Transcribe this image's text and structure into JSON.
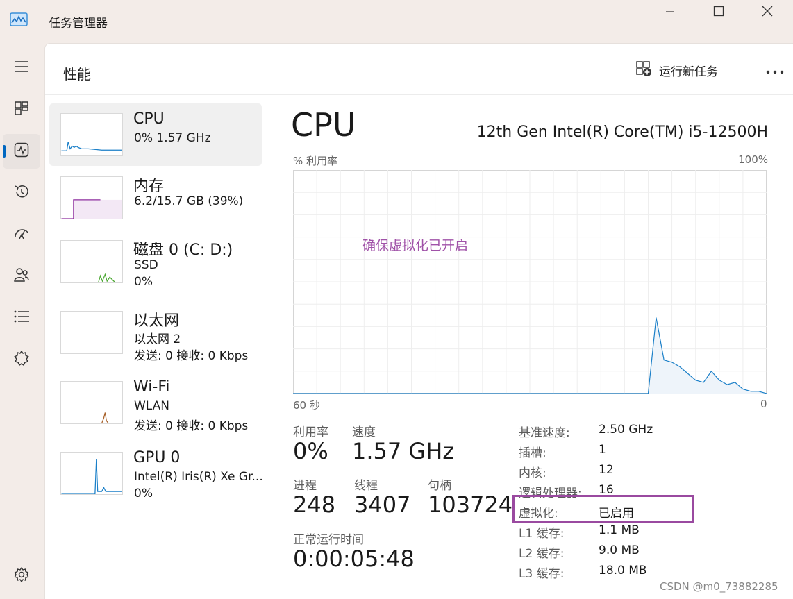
{
  "window": {
    "title": "任务管理器",
    "controls": {
      "minimize": "minimize-icon",
      "maximize": "maximize-icon",
      "close": "close-icon"
    }
  },
  "nav": {
    "items": [
      {
        "icon": "hamburger-icon"
      },
      {
        "icon": "processes-icon"
      },
      {
        "icon": "performance-icon"
      },
      {
        "icon": "app-history-icon"
      },
      {
        "icon": "startup-icon"
      },
      {
        "icon": "users-icon"
      },
      {
        "icon": "details-icon"
      },
      {
        "icon": "services-icon"
      }
    ],
    "settings_icon": "settings-icon"
  },
  "header": {
    "title": "性能",
    "run_task_label": "运行新任务",
    "more_icon": "more-icon"
  },
  "devices": [
    {
      "name": "CPU",
      "sub1": "0%  1.57 GHz",
      "sub2": "",
      "color": "#1a7fc8"
    },
    {
      "name": "内存",
      "sub1": "6.2/15.7 GB (39%)",
      "sub2": "",
      "color": "#8e2e9e"
    },
    {
      "name": "磁盘 0 (C: D:)",
      "sub1": "SSD",
      "sub2": "0%",
      "color": "#4ca832"
    },
    {
      "name": "以太网",
      "sub1": "以太网 2",
      "sub2": "发送: 0 接收: 0 Kbps",
      "color": "#a8622b"
    },
    {
      "name": "Wi-Fi",
      "sub1": "WLAN",
      "sub2": "发送: 0 接收: 0 Kbps",
      "color": "#a8622b"
    },
    {
      "name": "GPU 0",
      "sub1": "Intel(R) Iris(R) Xe Gr...",
      "sub2": "0%",
      "color": "#1a7fc8"
    }
  ],
  "detail": {
    "title": "CPU",
    "model": "12th Gen Intel(R) Core(TM) i5-12500H",
    "chart_top_left": "% 利用率",
    "chart_top_right": "100%",
    "chart_bottom_left": "60 秒",
    "chart_bottom_right": "0",
    "annotation": "确保虚拟化已开启",
    "stats": {
      "util_label": "利用率",
      "util_value": "0%",
      "speed_label": "速度",
      "speed_value": "1.57 GHz",
      "proc_label": "进程",
      "proc_value": "248",
      "thread_label": "线程",
      "thread_value": "3407",
      "handle_label": "句柄",
      "handle_value": "103724",
      "uptime_label": "正常运行时间",
      "uptime_value": "0:00:05:48"
    },
    "specs": [
      {
        "label": "基准速度:",
        "value": "2.50 GHz"
      },
      {
        "label": "插槽:",
        "value": "1"
      },
      {
        "label": "内核:",
        "value": "12"
      },
      {
        "label": "逻辑处理器:",
        "value": "16"
      },
      {
        "label": "虚拟化:",
        "value": "已启用"
      },
      {
        "label": "L1 缓存:",
        "value": "1.1 MB"
      },
      {
        "label": "L2 缓存:",
        "value": "9.0 MB"
      },
      {
        "label": "L3 缓存:",
        "value": "18.0 MB"
      }
    ]
  },
  "watermark": "CSDN @m0_73882285",
  "chart_data": {
    "type": "area",
    "title": "",
    "xlabel": "",
    "ylabel": "% 利用率",
    "x": [
      60,
      57,
      56,
      55,
      54,
      53,
      52,
      51,
      50,
      48,
      47,
      46,
      45,
      44,
      43,
      42,
      41,
      40,
      39,
      38,
      37,
      36,
      35,
      34,
      33,
      32,
      31,
      30,
      29,
      28,
      27,
      26,
      25,
      24,
      23,
      22,
      21,
      20,
      19,
      18,
      17,
      16,
      15,
      14,
      13,
      12,
      11,
      10,
      9,
      8,
      7,
      6,
      5,
      4,
      3,
      2,
      1,
      0
    ],
    "y": [
      0,
      0,
      0,
      0,
      0,
      0,
      0,
      0,
      0,
      0,
      0,
      0,
      0,
      0,
      0,
      0,
      0,
      0,
      0,
      0,
      0,
      0,
      0,
      0,
      0,
      0,
      0,
      0,
      0,
      0,
      0,
      0,
      0,
      0,
      0,
      0,
      0,
      0,
      0,
      0,
      0,
      0,
      0,
      34,
      15,
      14,
      12,
      9,
      6,
      5,
      10,
      6,
      4,
      5,
      2,
      1,
      1,
      0
    ],
    "xlim": [
      60,
      0
    ],
    "ylim": [
      0,
      100
    ],
    "grid": true,
    "series": [
      {
        "values": [
          34,
          15,
          14,
          12,
          9,
          6,
          5,
          10,
          6,
          4,
          5,
          2,
          1,
          1,
          0
        ]
      }
    ]
  }
}
